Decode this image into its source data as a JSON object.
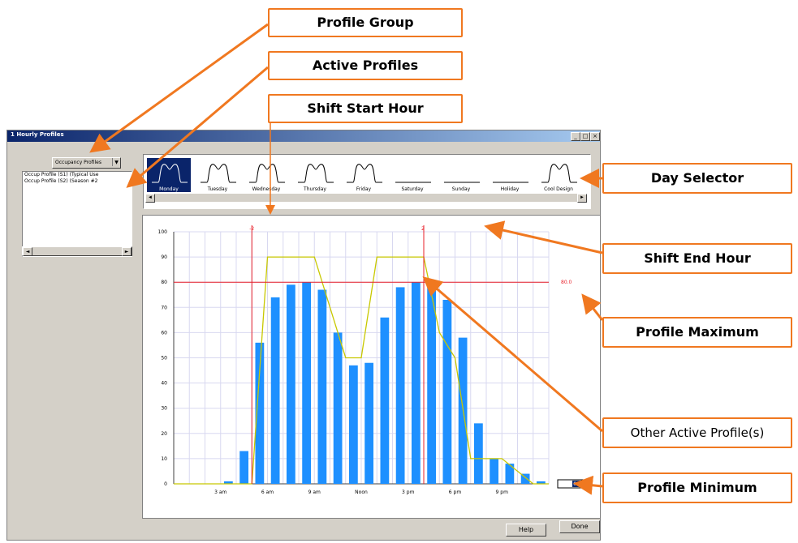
{
  "window": {
    "title": "Hourly Profiles",
    "title_prefix": "1",
    "minimize": "_",
    "maximize": "□",
    "close": "×"
  },
  "profile_group": {
    "selected": "Occupancy Profiles",
    "arrow": "▼"
  },
  "active_profiles": [
    "Occup Profile (S1) (Typical Use",
    "Occup Profile (S2) (Season #2"
  ],
  "scroll": {
    "left": "◄",
    "right": "►"
  },
  "days": [
    {
      "label": "Monday",
      "selected": true,
      "curve": true
    },
    {
      "label": "Tuesday",
      "selected": false,
      "curve": true
    },
    {
      "label": "Wednesday",
      "selected": false,
      "curve": true
    },
    {
      "label": "Thursday",
      "selected": false,
      "curve": true
    },
    {
      "label": "Friday",
      "selected": false,
      "curve": true
    },
    {
      "label": "Saturday",
      "selected": false,
      "curve": false
    },
    {
      "label": "Sunday",
      "selected": false,
      "curve": false
    },
    {
      "label": "Holiday",
      "selected": false,
      "curve": false
    },
    {
      "label": "Cool Design",
      "selected": false,
      "curve": true
    }
  ],
  "chart_data": {
    "type": "bar",
    "categories": [
      "1",
      "2",
      "3",
      "4",
      "5",
      "6",
      "7",
      "8",
      "9",
      "10",
      "11",
      "12",
      "13",
      "14",
      "15",
      "16",
      "17",
      "18",
      "19",
      "20",
      "21",
      "22",
      "23",
      "24"
    ],
    "values": [
      0,
      0,
      0,
      1,
      13,
      56,
      74,
      79,
      80,
      77,
      60,
      47,
      48,
      66,
      78,
      80,
      80,
      73,
      58,
      24,
      10,
      8,
      4,
      1
    ],
    "x_tick_labels": [
      "3 am",
      "6 am",
      "9 am",
      "Noon",
      "3 pm",
      "6 pm",
      "9 pm"
    ],
    "ylim": [
      0,
      100
    ],
    "y_ticks": [
      "0",
      "10",
      "20",
      "30",
      "40",
      "50",
      "60",
      "70",
      "80",
      "90",
      "100"
    ],
    "other_profile": {
      "x": [
        0,
        1,
        2,
        3,
        4,
        5,
        6,
        7,
        8,
        9,
        10,
        11,
        12,
        13,
        14,
        15,
        16,
        17,
        18,
        19,
        20,
        21,
        22,
        23,
        24
      ],
      "y": [
        0,
        0,
        0,
        0,
        0,
        0,
        90,
        90,
        90,
        90,
        70,
        50,
        50,
        90,
        90,
        90,
        90,
        60,
        50,
        10,
        10,
        10,
        5,
        0,
        0
      ]
    },
    "shift_start_label": "-2",
    "shift_end_label": "2",
    "profile_max": "80.0",
    "profile_min": "0.0",
    "bar_color": "#1e90ff",
    "line_color": "#c8c800",
    "marker_color": "#e8202a"
  },
  "buttons": {
    "help": "Help",
    "done": "Done"
  },
  "callouts": {
    "profile_group": "Profile Group",
    "active_profiles": "Active Profiles",
    "shift_start_hour": "Shift Start Hour",
    "day_selector": "Day Selector",
    "shift_end_hour": "Shift End Hour",
    "profile_maximum": "Profile Maximum",
    "other_active_profiles": "Other Active Profile(s)",
    "profile_minimum": "Profile Minimum"
  },
  "colors": {
    "callout_border": "#f07820",
    "title_bar": "#0a246a"
  }
}
